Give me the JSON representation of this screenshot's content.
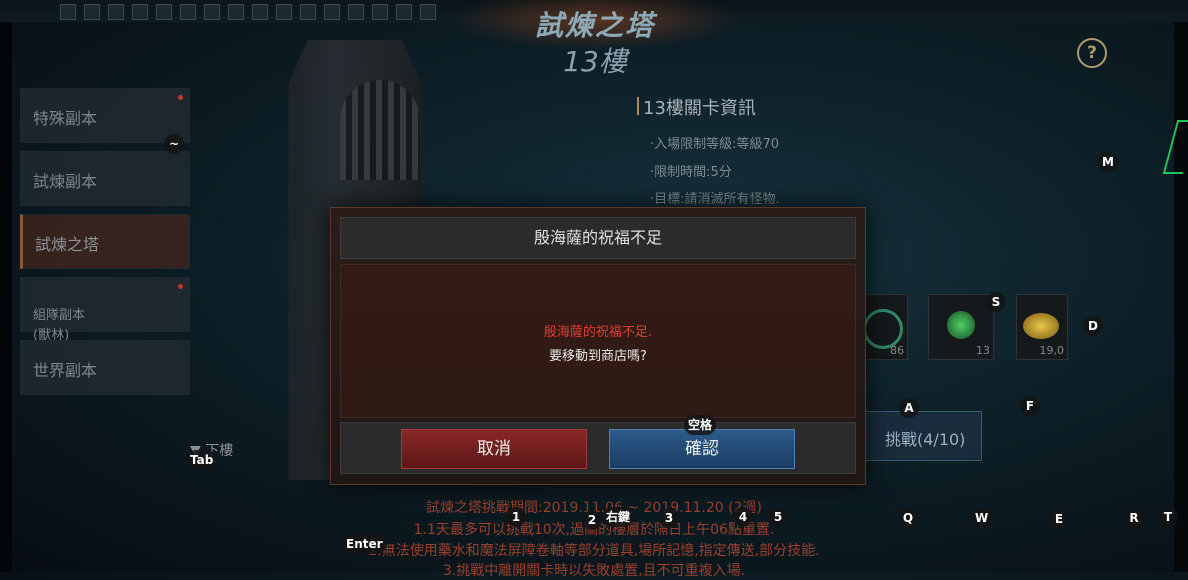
{
  "header": {
    "title": "試煉之塔",
    "subtitle": "13樓"
  },
  "sidebar": {
    "items": [
      {
        "label": "特殊副本",
        "has_dot": true,
        "active": false
      },
      {
        "label": "試煉副本",
        "has_dot": false,
        "active": false
      },
      {
        "label": "試煉之塔",
        "has_dot": false,
        "active": true
      },
      {
        "label": "組隊副本\n(獸林)",
        "has_dot": true,
        "active": false
      },
      {
        "label": "世界副本",
        "has_dot": false,
        "active": false
      }
    ],
    "floor_label": "下樓"
  },
  "stage_info": {
    "title": "13樓關卡資訊",
    "lines": [
      "·入場限制等級:等級70",
      "·限制時間:5分",
      "·目標:請消滅所有怪物."
    ]
  },
  "rewards": [
    {
      "icon": "green-orb-icon",
      "count": "86"
    },
    {
      "icon": "star-gem-icon",
      "count": "13"
    },
    {
      "icon": "gold-coins-icon",
      "count": "19,0"
    }
  ],
  "challenge_button": "挑戰(4/10)",
  "bottom_text": [
    "試煉之塔挑戰期間:2019.11.06 ~ 2019.11.20 (2週)",
    "1.1天最多可以挑戰10次,過關的樓層於隔日上午06點重置.",
    "2.無法使用藥水和魔法屏障卷軸等部分道具,場所記憶,指定傳送,部分技能.",
    "3.挑戰中離開關卡時以失敗處置,且不可重複入場."
  ],
  "dialog": {
    "title": "殷海薩的祝福不足",
    "message_warning": "殷海薩的祝福不足.",
    "message_question": "要移動到商店嗎?",
    "cancel_label": "取消",
    "confirm_label": "確認"
  },
  "key_hints": {
    "tilde": "~",
    "m": "M",
    "s": "S",
    "d": "D",
    "a": "A",
    "f": "F",
    "space": "空格",
    "tab": "Tab",
    "enter": "Enter",
    "k1": "1",
    "k2": "2",
    "right_click": "右鍵",
    "k3": "3",
    "k4": "4",
    "k5": "5",
    "q": "Q",
    "w": "W",
    "e": "E",
    "r": "R",
    "t": "T"
  },
  "colors": {
    "warning_red": "#e23b2e",
    "cancel_red": "#8a2626",
    "confirm_blue": "#2c5b8a"
  }
}
